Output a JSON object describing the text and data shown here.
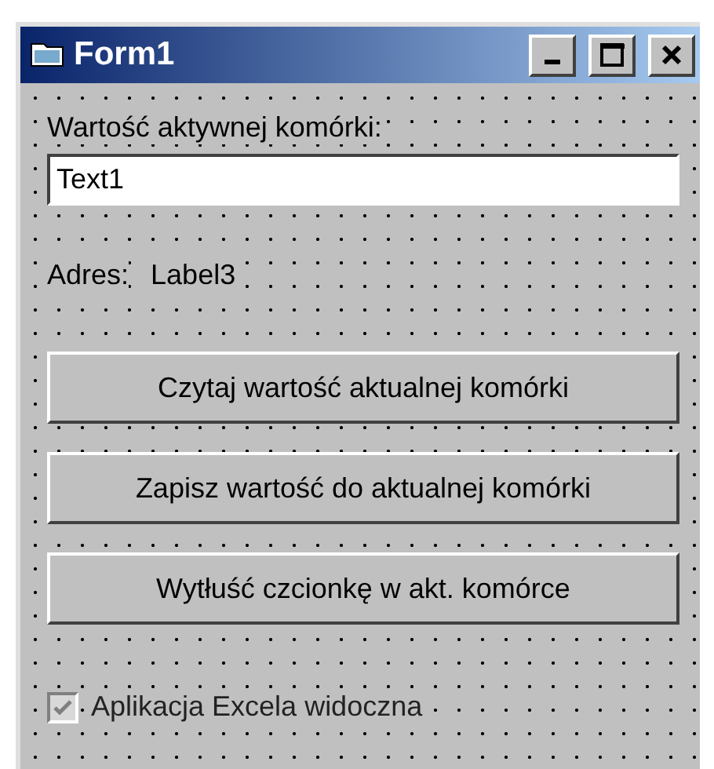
{
  "window": {
    "title": "Form1"
  },
  "value_label": "Wartość aktywnej komórki:",
  "value_field": {
    "value": "Text1"
  },
  "address": {
    "caption": "Adres:",
    "value": "Label3"
  },
  "buttons": [
    "Czytaj wartość aktualnej komórki",
    "Zapisz wartość do aktualnej komórki",
    "Wytłuść czcionkę w akt. komórce"
  ],
  "checkbox": {
    "label": "Aplikacja Excela widoczna",
    "checked": true,
    "disabled": true
  }
}
